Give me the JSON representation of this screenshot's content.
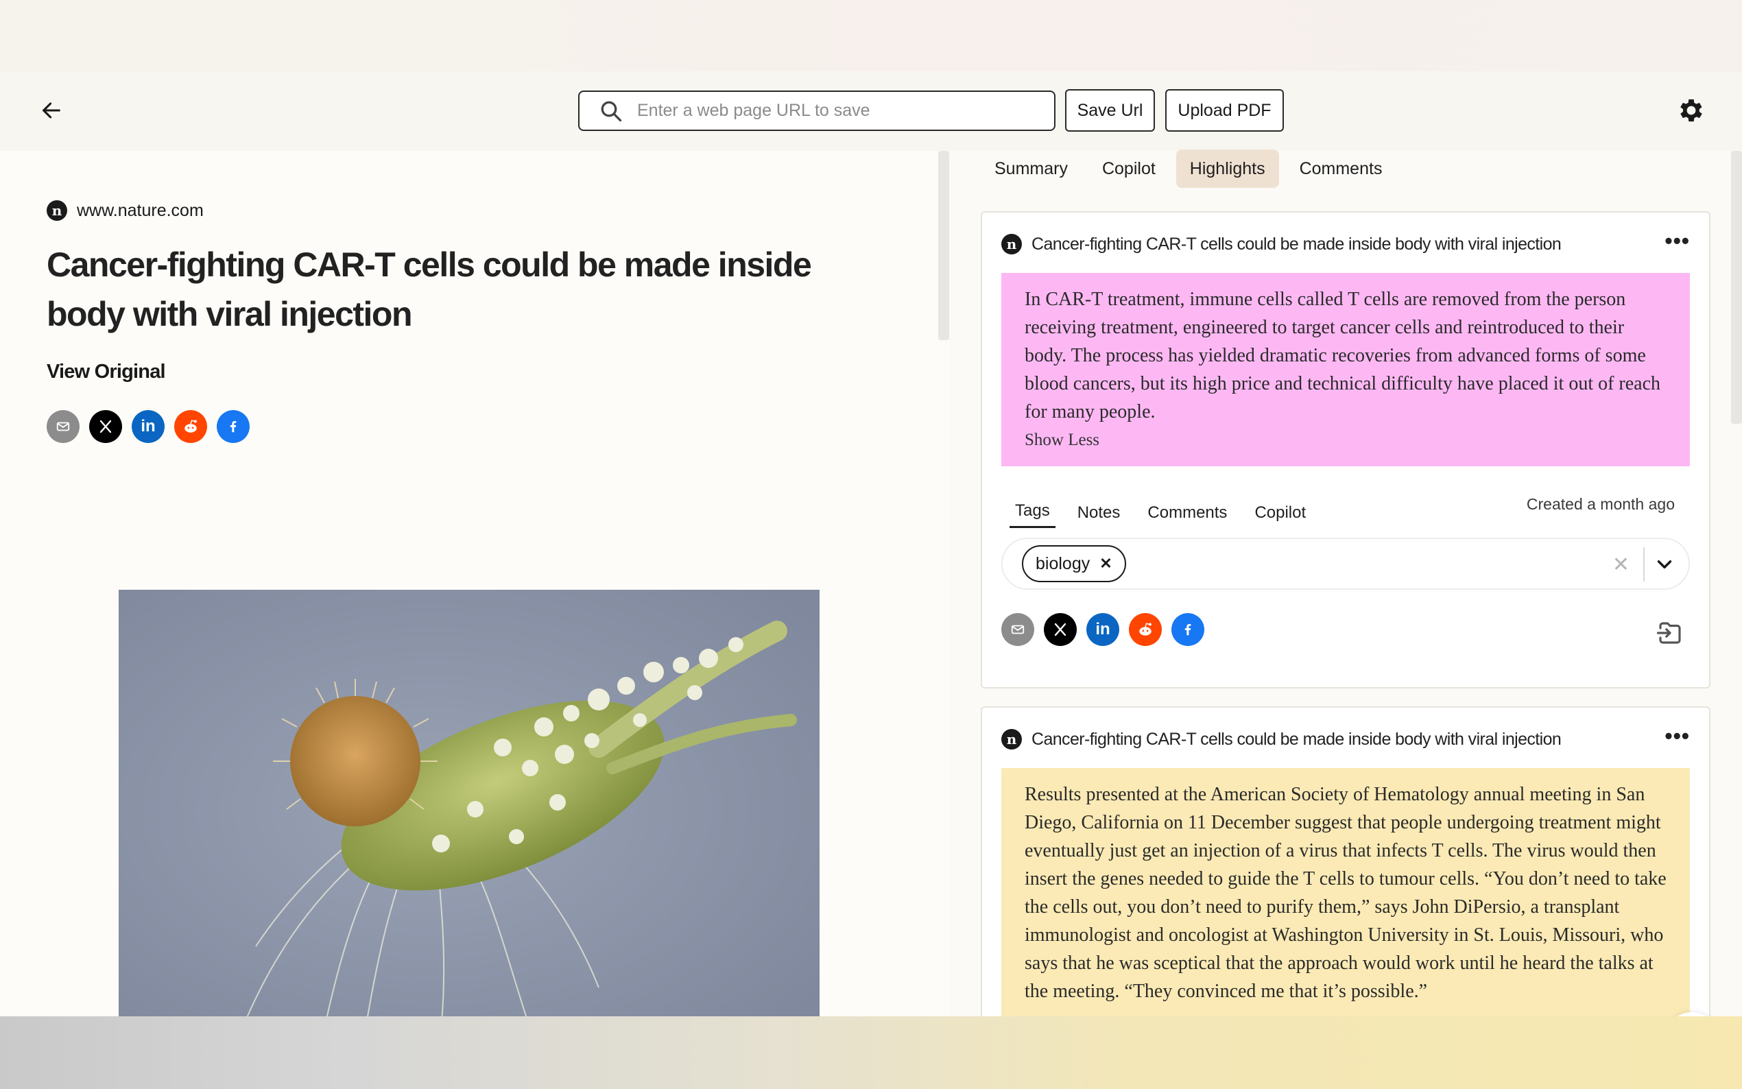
{
  "header": {
    "search_placeholder": "Enter a web page URL to save",
    "save_url_label": "Save Url",
    "upload_pdf_label": "Upload PDF"
  },
  "article": {
    "site": "www.nature.com",
    "site_logo_letter": "n",
    "title": "Cancer-fighting CAR-T cells could be made inside body with viral injection",
    "view_original": "View Original",
    "share_icons": [
      "email-icon",
      "x-icon",
      "linkedin-icon",
      "reddit-icon",
      "facebook-icon"
    ],
    "image_description_icon": "cell-micrograph"
  },
  "panel": {
    "tabs": [
      {
        "label": "Summary"
      },
      {
        "label": "Copilot"
      },
      {
        "label": "Highlights"
      },
      {
        "label": "Comments"
      }
    ],
    "active_tab": "Highlights",
    "cards": [
      {
        "title": "Cancer-fighting CAR-T cells could be made inside body with viral injection",
        "highlight_color": "#fdb8f4",
        "text": "In CAR-T treatment, immune cells called T cells are removed from the person receiving treatment, engineered to target cancer cells and reintroduced to their body. The process has yielded dramatic recoveries from advanced forms of some blood cancers, but its high price and technical difficulty have placed it out of reach for many people.",
        "show_less": "Show Less",
        "sub_tabs": [
          "Tags",
          "Notes",
          "Comments",
          "Copilot"
        ],
        "created": "Created a month ago",
        "tags": [
          "biology"
        ]
      },
      {
        "title": "Cancer-fighting CAR-T cells could be made inside body with viral injection",
        "highlight_color": "#fbeab5",
        "text": "Results presented at the American Society of Hematology annual meeting in San Diego, California on 11 December suggest that people undergoing treatment might eventually just get an injection of a virus that infects T cells. The virus would then insert the genes needed to guide the T cells to tumour cells. “You don’t need to take the cells out, you don’t need to purify them,” says John DiPersio, a transplant immunologist and oncologist at Washington University in St. Louis, Missouri, who says that he was sceptical that the approach would work until he heard the talks at the meeting. “They convinced me that it’s possible.”"
      }
    ]
  }
}
